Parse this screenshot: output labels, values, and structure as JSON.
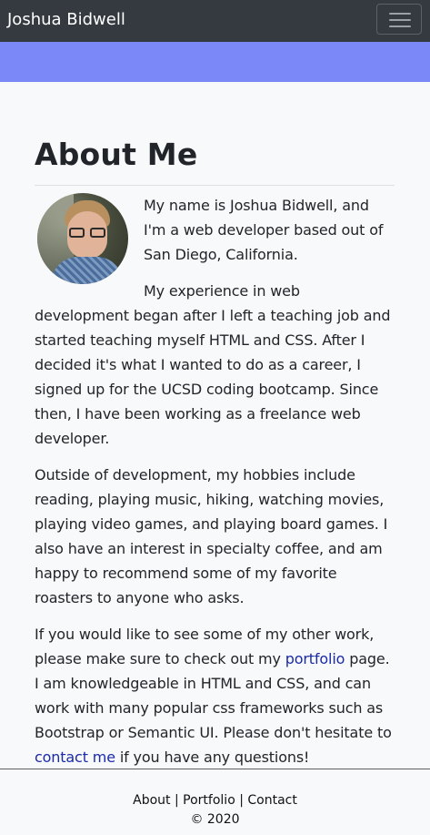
{
  "navbar": {
    "brand": "Joshua Bidwell",
    "toggle_icon": "hamburger-menu-icon"
  },
  "colors": {
    "navbar_bg": "#343a40",
    "banner_bg": "#7b88f7",
    "page_bg": "#f8f9fb",
    "link": "#1a2aa8"
  },
  "about": {
    "title": "About Me",
    "avatar_alt": "profile photo",
    "p1": "My name is Joshua Bidwell, and I'm a web developer based out of San Diego, California.",
    "p2": "My experience in web development began after I left a teaching job and started teaching myself HTML and CSS. After I decided it's what I wanted to do as a career, I signed up for the UCSD coding bootcamp. Since then, I have been working as a freelance web developer.",
    "p3": "Outside of development, my hobbies include reading, playing music, hiking, watching movies, playing video games, and playing board games. I also have an interest in specialty coffee, and am happy to recommend some of my favorite roasters to anyone who asks.",
    "p4_a": "If you would like to see some of my other work, please make sure to check out my ",
    "p4_link1": "portfolio",
    "p4_b": " page. I am knowledgeable in HTML and CSS, and can work with many popular css frameworks such as Bootstrap or Semantic UI. Please don't hesitate to ",
    "p4_link2": "contact me",
    "p4_c": " if you have any questions!"
  },
  "footer": {
    "about": "About",
    "portfolio": "Portfolio",
    "contact": "Contact",
    "separator": " | ",
    "copyright": "© 2020"
  }
}
